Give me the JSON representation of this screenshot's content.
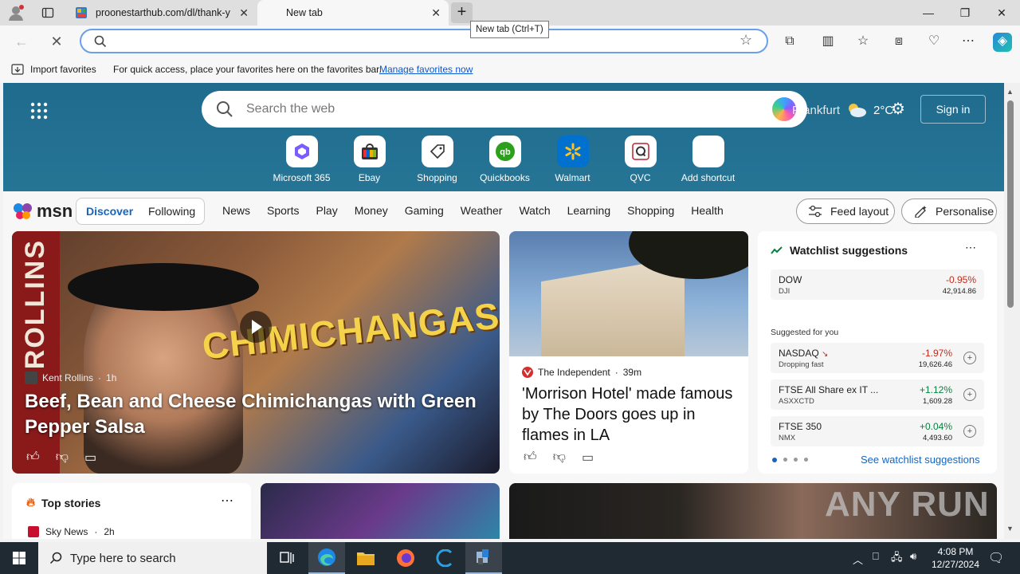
{
  "browser": {
    "tabs": [
      {
        "title": "proonestarthub.com/dl/thank-y",
        "favicon": "proonestarthub-favicon"
      },
      {
        "title": "New tab",
        "favicon": "none"
      }
    ],
    "new_tab_tooltip": "New tab (Ctrl+T)",
    "address_bar": {
      "value": "",
      "placeholder": ""
    },
    "favorites_bar": {
      "import_label": "Import favorites",
      "message": "For quick access, place your favorites here on the favorites bar.",
      "link": "Manage favorites now"
    }
  },
  "newtab": {
    "search_placeholder": "Search the web",
    "weather": {
      "location": "Frankfurt",
      "temp": "2°C"
    },
    "sign_in_label": "Sign in",
    "shortcuts": [
      {
        "label": "Microsoft 365",
        "icon": "m365-icon",
        "color": "#7b5cff"
      },
      {
        "label": "Ebay",
        "icon": "ebay-icon",
        "color": "#e53238"
      },
      {
        "label": "Shopping",
        "icon": "shopping-tag-icon",
        "color": "#333333"
      },
      {
        "label": "Quickbooks",
        "icon": "quickbooks-icon",
        "color": "#2ca01c"
      },
      {
        "label": "Walmart",
        "icon": "walmart-icon",
        "color": "#0071ce"
      },
      {
        "label": "QVC",
        "icon": "qvc-icon",
        "color": "#c21f32"
      },
      {
        "label": "Add shortcut",
        "icon": "plus-icon",
        "color": "#333333"
      }
    ]
  },
  "msn": {
    "logo": "msn",
    "discover_label": "Discover",
    "following_label": "Following",
    "nav": [
      "News",
      "Sports",
      "Play",
      "Money",
      "Gaming",
      "Weather",
      "Watch",
      "Learning",
      "Shopping",
      "Health"
    ],
    "feed_layout_label": "Feed layout",
    "personalise_label": "Personalise"
  },
  "feed": {
    "hero": {
      "source": "Kent Rollins",
      "time": "1h",
      "title": "Beef, Bean and Cheese Chimichangas with Green Pepper Salsa",
      "overlay_text": "CHIMICHANGAS",
      "band_text": "ROLLINS"
    },
    "card2": {
      "source": "The Independent",
      "time": "39m",
      "title": "'Morrison Hotel' made famous by The Doors goes up in flames in LA"
    },
    "watchlist": {
      "title": "Watchlist suggestions",
      "suggested_label": "Suggested for you",
      "see_all": "See watchlist suggestions",
      "rows": [
        {
          "symbol": "DOW",
          "sub": "DJI",
          "change": "-0.95%",
          "price": "42,914.86",
          "dir": "neg"
        },
        {
          "symbol": "NASDAQ",
          "sub": "Dropping fast",
          "change": "-1.97%",
          "price": "19,626.46",
          "dir": "neg"
        },
        {
          "symbol": "FTSE All Share ex IT ...",
          "sub": "ASXXCTD",
          "change": "+1.12%",
          "price": "1,609.28",
          "dir": "pos"
        },
        {
          "symbol": "FTSE 350",
          "sub": "NMX",
          "change": "+0.04%",
          "price": "4,493.60",
          "dir": "pos"
        }
      ]
    },
    "top_stories": {
      "title": "Top stories",
      "source": "Sky News",
      "time": "2h"
    },
    "watermark": "ANY RUN"
  },
  "taskbar": {
    "search_placeholder": "Type here to search",
    "time": "4:08 PM",
    "date": "12/27/2024"
  }
}
